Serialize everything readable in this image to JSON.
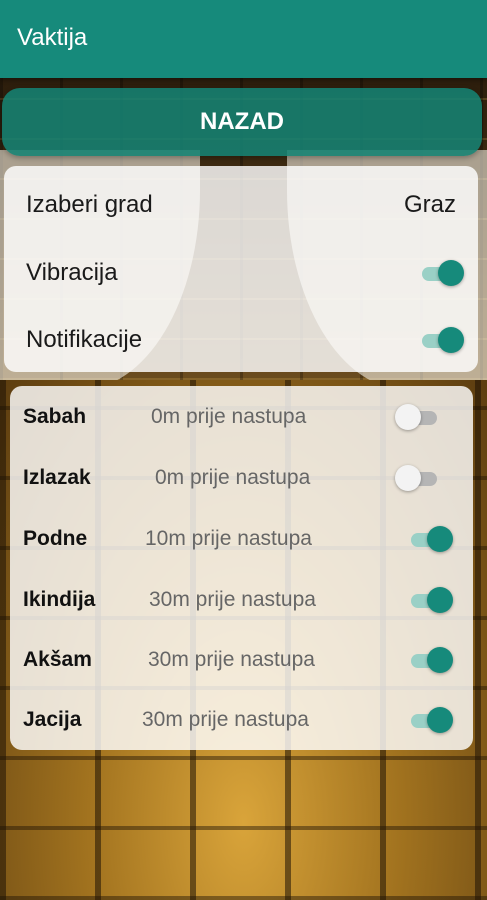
{
  "app": {
    "title": "Vaktija"
  },
  "back_button": {
    "label": "NAZAD"
  },
  "settings": {
    "city_label": "Izaberi grad",
    "city_value": "Graz",
    "vibration_label": "Vibracija",
    "vibration_on": true,
    "notifications_label": "Notifikacije",
    "notifications_on": true
  },
  "prayer_times": [
    {
      "name": "Sabah",
      "reminder": "0m prije nastupa",
      "enabled": false
    },
    {
      "name": "Izlazak",
      "reminder": "0m prije nastupa",
      "enabled": false
    },
    {
      "name": "Podne",
      "reminder": "10m prije nastupa",
      "enabled": true
    },
    {
      "name": "Ikindija",
      "reminder": "30m prije nastupa",
      "enabled": true
    },
    {
      "name": "Akšam",
      "reminder": "30m prije nastupa",
      "enabled": true
    },
    {
      "name": "Jacija",
      "reminder": "30m prije nastupa",
      "enabled": true
    }
  ],
  "colors": {
    "primary": "#168a7b",
    "switch_track_on": "#9ad0c6",
    "switch_track_off": "#b5b5b5"
  }
}
